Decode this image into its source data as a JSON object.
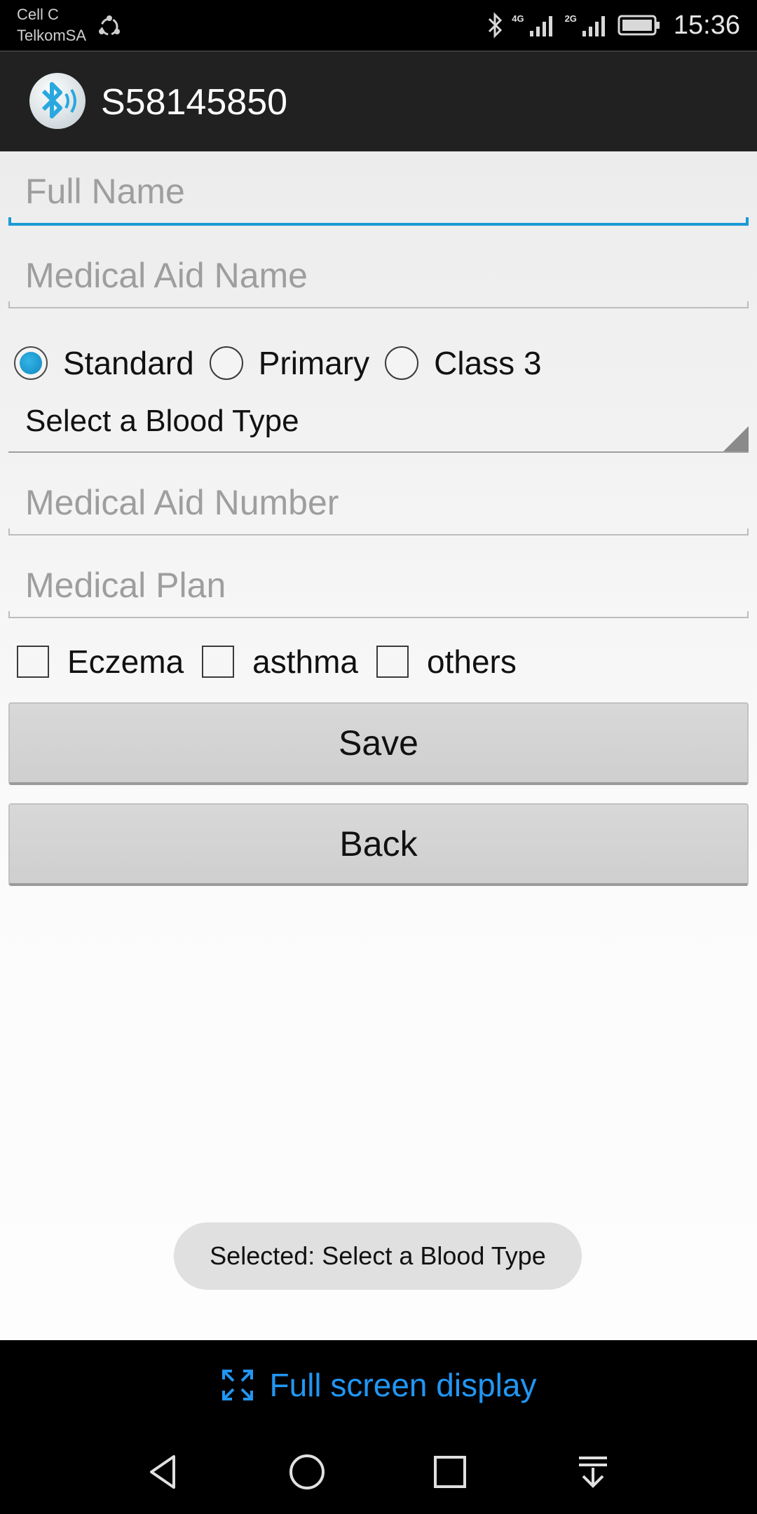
{
  "status_bar": {
    "carrier_line1": "Cell C",
    "carrier_line2": "TelkomSA",
    "network_4g": "4G",
    "network_2g": "2G",
    "time": "15:36"
  },
  "app_bar": {
    "title": "S58145850"
  },
  "form": {
    "full_name_placeholder": "Full Name",
    "medical_aid_name_placeholder": "Medical Aid Name",
    "radios": [
      {
        "label": "Standard",
        "checked": true
      },
      {
        "label": "Primary",
        "checked": false
      },
      {
        "label": "Class 3",
        "checked": false
      }
    ],
    "blood_type_selected": "Select a Blood Type",
    "medical_aid_number_placeholder": "Medical Aid Number",
    "medical_plan_placeholder": "Medical Plan",
    "checkboxes": [
      {
        "label": "Eczema",
        "checked": false
      },
      {
        "label": "asthma",
        "checked": false
      },
      {
        "label": "others",
        "checked": false
      }
    ],
    "save_label": "Save",
    "back_label": "Back"
  },
  "toast": {
    "message": "Selected: Select a Blood Type"
  },
  "fullscreen_bar": {
    "label": "Full screen display",
    "icon": "expand-icon"
  },
  "nav_bar": {
    "icons": [
      "back-triangle-icon",
      "home-circle-icon",
      "recents-square-icon",
      "notification-pull-icon"
    ]
  },
  "colors": {
    "accent": "#1a9ad6",
    "fullscreen_link": "#2196f3",
    "app_bar": "#212121"
  }
}
